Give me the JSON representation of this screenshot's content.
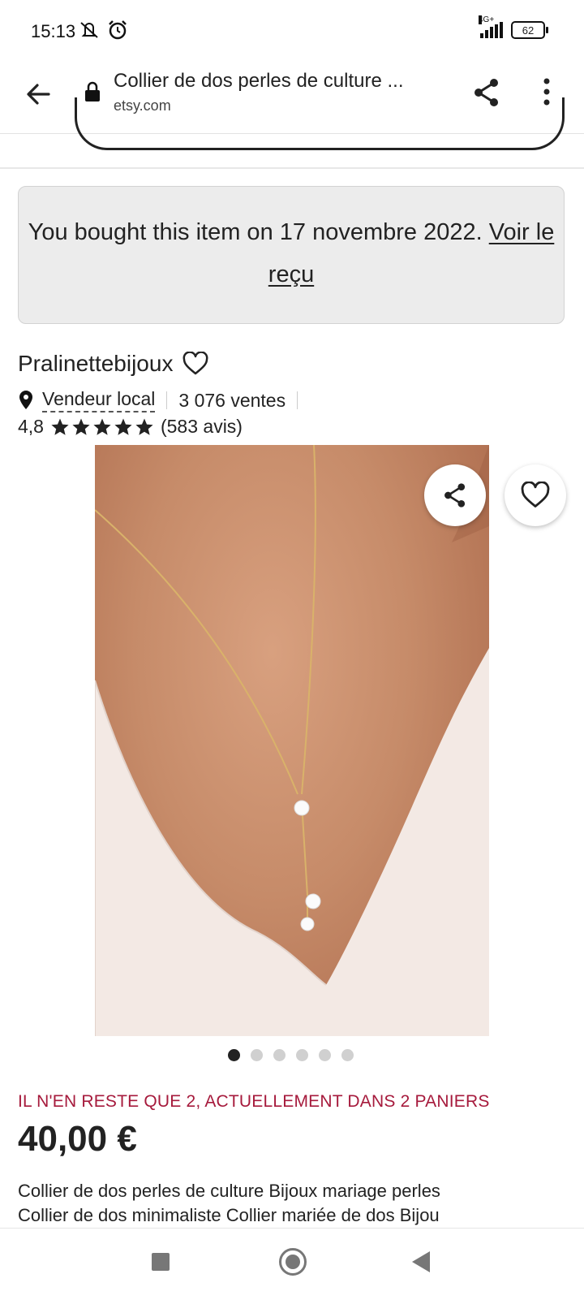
{
  "status_bar": {
    "time": "15:13",
    "network": "4G+",
    "battery": "62"
  },
  "browser": {
    "title": "Collier de dos perles de culture ...",
    "domain": "etsy.com"
  },
  "notice": {
    "text": "You bought this item on 17 novembre 2022.",
    "link": "Voir le reçu"
  },
  "shop": {
    "name": "Pralinettebijoux",
    "local_seller": "Vendeur local",
    "sales": "3 076 ventes",
    "rating": "4,8",
    "stars": 5,
    "reviews": "(583 avis)"
  },
  "gallery": {
    "image_count": 6,
    "active_index": 0
  },
  "product": {
    "stock_alert": "IL N'EN RESTE QUE 2, ACTUELLEMENT DANS 2 PANIERS",
    "price": "40,00 €",
    "description_line1": "Collier de dos perles de culture Bijoux mariage perles",
    "description_line2": "Collier de dos minimaliste Collier mariée de dos Bijou"
  },
  "colors": {
    "alert": "#a61a3c",
    "notice_bg": "#ececec"
  }
}
